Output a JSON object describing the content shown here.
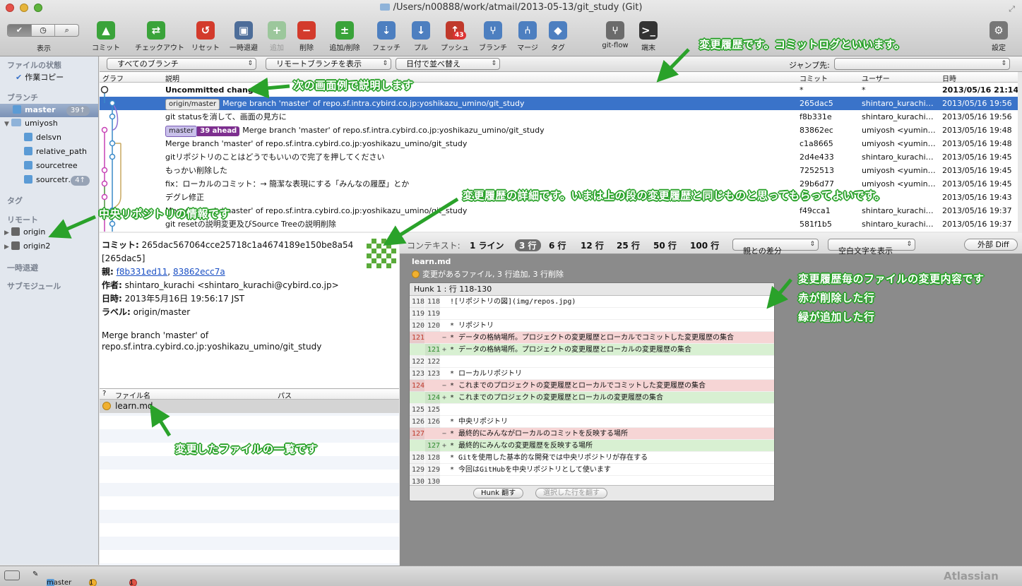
{
  "window": {
    "title": "/Users/n00888/work/atmail/2013-05-13/git_study (Git)"
  },
  "view": {
    "label": "表示",
    "segments": [
      "✔",
      "◷",
      "⌕"
    ]
  },
  "toolbar": [
    {
      "key": "commit",
      "label": "コミット",
      "color": "#3aa33a",
      "glyph": "▲"
    },
    {
      "key": "checkout",
      "label": "チェックアウト",
      "color": "#3aa33a",
      "glyph": "⇄"
    },
    {
      "key": "reset",
      "label": "リセット",
      "color": "#d33b2c",
      "glyph": "↺"
    },
    {
      "key": "stash",
      "label": "一時退避",
      "color": "#4d6d99",
      "glyph": "▣"
    },
    {
      "key": "add",
      "label": "追加",
      "color": "#9cc79c",
      "glyph": "+"
    },
    {
      "key": "remove",
      "label": "削除",
      "color": "#d33b2c",
      "glyph": "−"
    },
    {
      "key": "addremove",
      "label": "追加/削除",
      "color": "#3aa33a",
      "glyph": "±"
    },
    {
      "key": "fetch",
      "label": "フェッチ",
      "color": "#4d7fc0",
      "glyph": "⇣"
    },
    {
      "key": "pull",
      "label": "プル",
      "color": "#4d7fc0",
      "glyph": "↓"
    },
    {
      "key": "push",
      "label": "プッシュ",
      "color": "#c0392b",
      "glyph": "↑",
      "badge": "43"
    },
    {
      "key": "branch",
      "label": "ブランチ",
      "color": "#4d7fc0",
      "glyph": "⑂"
    },
    {
      "key": "merge",
      "label": "マージ",
      "color": "#4d7fc0",
      "glyph": "⑃"
    },
    {
      "key": "tag",
      "label": "タグ",
      "color": "#4d7fc0",
      "glyph": "◆"
    },
    {
      "key": "gitflow",
      "label": "git-flow",
      "color": "#6b6b6b",
      "glyph": "⑂"
    },
    {
      "key": "terminal",
      "label": "端末",
      "color": "#333",
      "glyph": ">_"
    },
    {
      "key": "settings",
      "label": "設定",
      "color": "#777",
      "glyph": "⚙"
    }
  ],
  "sidebar": {
    "file_status": "ファイルの状態",
    "working_copy": "作業コピー",
    "branches": "ブランチ",
    "master": "master",
    "master_badge": "39↑",
    "umiyosh": "umiyosh",
    "delsvn": "delsvn",
    "relative_path": "relative_path",
    "sourcetree": "sourcetree",
    "sourcetr2": "sourcetr…",
    "sourcetr2_badge": "4↑",
    "tags": "タグ",
    "remotes": "リモート",
    "origin": "origin",
    "origin2": "origin2",
    "stashes": "一時退避",
    "submodules": "サブモジュール"
  },
  "filters": {
    "all_branches": "すべてのブランチ",
    "show_remote": "リモートブランチを表示",
    "sort_date": "日付で並べ替え",
    "jump": "ジャンプ先:"
  },
  "history": {
    "headers": {
      "graph": "グラフ",
      "desc": "説明",
      "commit": "コミット",
      "user": "ユーザー",
      "date": "日時"
    },
    "rows": [
      {
        "desc": "Uncommitted changes",
        "hash": "*",
        "user": "*",
        "date": "2013/05/16 21:14"
      },
      {
        "tag": "origin/master",
        "desc": "Merge branch 'master' of repo.sf.intra.cybird.co.jp:yoshikazu_umino/git_study",
        "hash": "265dac5",
        "user": "shintaro_kurachi…",
        "date": "2013/05/16 19:56"
      },
      {
        "desc": "git statusを消して、画面の見方に",
        "hash": "f8b331e",
        "user": "shintaro_kurachi…",
        "date": "2013/05/16 19:56"
      },
      {
        "tag": "master",
        "ahead": "39 ahead",
        "desc": "Merge branch 'master' of repo.sf.intra.cybird.co.jp:yoshikazu_umino/git_study",
        "hash": "83862ec",
        "user": "umiyosh <yumin…",
        "date": "2013/05/16 19:48"
      },
      {
        "desc": "Merge branch 'master' of repo.sf.intra.cybird.co.jp:yoshikazu_umino/git_study",
        "hash": "c1a8665",
        "user": "umiyosh <yumin…",
        "date": "2013/05/16 19:48"
      },
      {
        "desc": "gitリポジトリのことはどうでもいいので完了を押してください",
        "hash": "2d4e433",
        "user": "shintaro_kurachi…",
        "date": "2013/05/16 19:45"
      },
      {
        "desc": "もっかい削除した",
        "hash": "7252513",
        "user": "umiyosh <yumin…",
        "date": "2013/05/16 19:45"
      },
      {
        "desc": "fix：ローカルのコミット：→ 簡潔な表現にする「みんなの履歴」とか",
        "hash": "29b6d77",
        "user": "umiyosh <yumin…",
        "date": "2013/05/16 19:45"
      },
      {
        "desc": "デグレ修正",
        "hash": "",
        "user": "",
        "date": "2013/05/16 19:43"
      },
      {
        "desc": "Merge branch 'master' of repo.sf.intra.cybird.co.jp:yoshikazu_umino/git_study",
        "hash": "f49cca1",
        "user": "shintaro_kurachi…",
        "date": "2013/05/16 19:37"
      },
      {
        "desc": "git resetの説明変更及びSource Treeの説明削除",
        "hash": "581f1b5",
        "user": "shintaro_kurachi…",
        "date": "2013/05/16 19:37"
      }
    ]
  },
  "details": {
    "commit_label": "コミット:",
    "commit": "265dac567064cce25718c1a4674189e150be8a54",
    "commit_short": "[265dac5]",
    "parents_label": "親:",
    "parent1": "f8b331ed11",
    "parent2": "83862ecc7a",
    "author_label": "作者:",
    "author": "shintaro_kurachi <shintaro_kurachi@cybird.co.jp>",
    "date_label": "日時:",
    "date": "2013年5月16日 19:56:17 JST",
    "labels_label": "ラベル:",
    "labels": "origin/master",
    "message1": "Merge branch 'master' of",
    "message2": "repo.sf.intra.cybird.co.jp:yoshikazu_umino/git_study"
  },
  "files": {
    "headers": {
      "status": "?",
      "name": "ファイル名",
      "path": "パス"
    },
    "items": [
      {
        "name": "learn.md"
      }
    ]
  },
  "diff": {
    "context_label": "コンテキスト:",
    "context_options": [
      "1 ライン",
      "3 行",
      "6 行",
      "12 行",
      "25 行",
      "50 行",
      "100 行"
    ],
    "context_selected": "3 行",
    "vs_parent": "親との差分",
    "show_ws": "空白文字を表示",
    "external": "外部 Diff",
    "filename": "learn.md",
    "summary": "変更があるファイル, 3 行追加, 3 行削除",
    "reverse": "翻す",
    "hunk_title": "Hunk 1 : 行 118-130",
    "lines": [
      {
        "a": "118",
        "b": "118",
        "s": "",
        "t": "![リポジトリの図](img/repos.jpg)",
        "k": "ctx"
      },
      {
        "a": "119",
        "b": "119",
        "s": "",
        "t": "",
        "k": "ctx"
      },
      {
        "a": "120",
        "b": "120",
        "s": "",
        "t": "* リポジトリ",
        "k": "ctx"
      },
      {
        "a": "121",
        "b": "",
        "s": "−",
        "t": "  * データの格納場所。プロジェクトの変更履歴とローカルでコミットした変更履歴の集合",
        "k": "del"
      },
      {
        "a": "",
        "b": "121",
        "s": "+",
        "t": "  * データの格納場所。プロジェクトの変更履歴とローカルの変更履歴の集合",
        "k": "add"
      },
      {
        "a": "122",
        "b": "122",
        "s": "",
        "t": "",
        "k": "ctx"
      },
      {
        "a": "123",
        "b": "123",
        "s": "",
        "t": "* ローカルリポジトリ",
        "k": "ctx"
      },
      {
        "a": "124",
        "b": "",
        "s": "−",
        "t": "  * これまでのプロジェクトの変更履歴とローカルでコミットした変更履歴の集合",
        "k": "del"
      },
      {
        "a": "",
        "b": "124",
        "s": "+",
        "t": "  * これまでのプロジェクトの変更履歴とローカルの変更履歴の集合",
        "k": "add"
      },
      {
        "a": "125",
        "b": "125",
        "s": "",
        "t": "",
        "k": "ctx"
      },
      {
        "a": "126",
        "b": "126",
        "s": "",
        "t": "* 中央リポジトリ",
        "k": "ctx"
      },
      {
        "a": "127",
        "b": "",
        "s": "−",
        "t": "  * 最終的にみんながローカルのコミットを反映する場所",
        "k": "del"
      },
      {
        "a": "",
        "b": "127",
        "s": "+",
        "t": "  * 最終的にみんなの変更履歴を反映する場所",
        "k": "add"
      },
      {
        "a": "128",
        "b": "128",
        "s": "",
        "t": "  * Gitを使用した基本的な開発では中央リポジトリが存在する",
        "k": "ctx"
      },
      {
        "a": "129",
        "b": "129",
        "s": "",
        "t": "  * 今回はGitHubを中央リポジトリとして使います",
        "k": "ctx"
      },
      {
        "a": "130",
        "b": "130",
        "s": "",
        "t": "",
        "k": "ctx"
      }
    ],
    "hunk_reverse": "Hunk 翻す",
    "selected_reverse": "選択した行を翻す"
  },
  "status": {
    "branch": "master",
    "changes": "1 変更",
    "deletions": "1 削除",
    "brand": "Atlassian"
  },
  "annotations": {
    "a1": "変更履歴です。コミットログといいます。",
    "a2": "次の画面例で説明します",
    "a3": "変更履歴の詳細です。いまは上の段の変更履歴と同じものと思ってもらってよいです。",
    "a4": "中央リポジトリの情報です",
    "a5": "変更履歴毎のファイルの変更内容です",
    "a6": "赤が削除した行",
    "a7": "緑が追加した行",
    "a8": "変更したファイルの一覧です"
  }
}
